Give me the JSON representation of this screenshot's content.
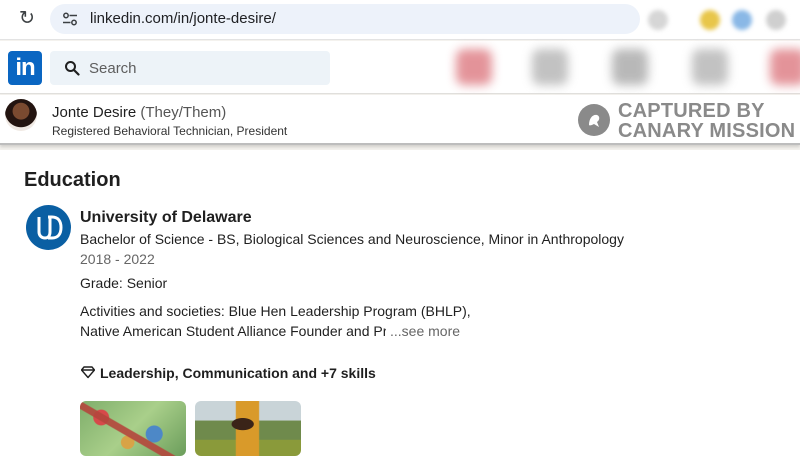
{
  "browser": {
    "url": "linkedin.com/in/jonte-desire/"
  },
  "linkedin_nav": {
    "logo_text": "in",
    "search_placeholder": "Search"
  },
  "profile_header": {
    "name": "Jonte Desire",
    "pronouns": "(They/Them)",
    "headline": "Registered Behavioral Technician, President"
  },
  "watermark": {
    "line1": "CAPTURED BY",
    "line2": "CANARY MISSION"
  },
  "education": {
    "section_title": "Education",
    "entries": [
      {
        "school": "University of Delaware",
        "degree": "Bachelor of Science - BS, Biological Sciences and Neuroscience, Minor in Anthropology",
        "dates": "2018 - 2022",
        "grade": "Grade: Senior",
        "activities_line1": "Activities and societies: Blue Hen Leadership Program (BHLP),",
        "activities_line2": "Native American Student Alliance Founder and President",
        "see_more": "...see more",
        "skills": "Leadership, Communication and +7 skills"
      }
    ]
  },
  "colors": {
    "linkedin_blue": "#0a66c2",
    "school_logo_blue": "#0a5fa3",
    "watermark_gray": "#8a8a8a"
  }
}
